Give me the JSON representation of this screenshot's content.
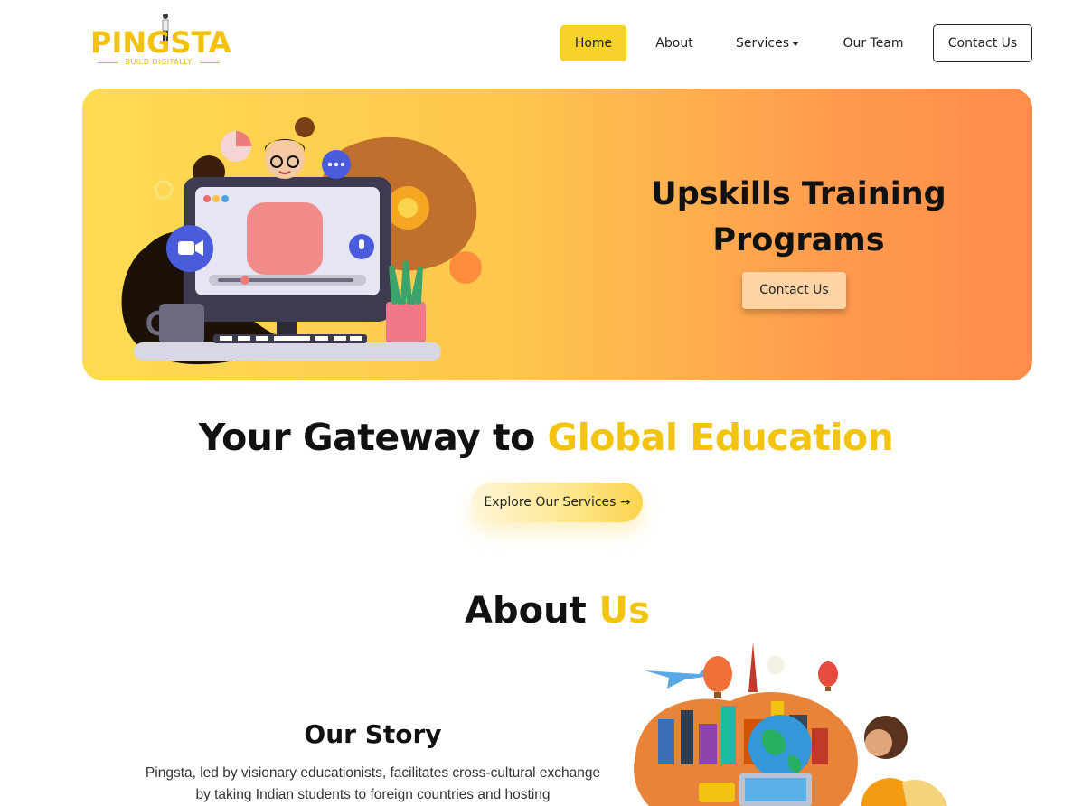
{
  "brand": {
    "name": "PINGSTA",
    "tagline": "BUILD DIGITALLY",
    "color": "#f2c20f"
  },
  "nav": {
    "items": [
      {
        "label": "Home",
        "active": true
      },
      {
        "label": "About"
      },
      {
        "label": "Services",
        "has_dropdown": true
      },
      {
        "label": "Our Team"
      }
    ],
    "contact_label": "Contact Us"
  },
  "hero": {
    "title": "Upskills Training Programs",
    "button_label": "Contact Us",
    "gradient": [
      "#fedc52",
      "#ff8c4b"
    ]
  },
  "gateway": {
    "prefix": "Your Gateway to",
    "highlight": "Global Education",
    "button_label": "Explore Our Services →"
  },
  "about": {
    "title_prefix": "About",
    "title_highlight": "Us",
    "story_title": "Our Story",
    "story_text": "Pingsta, led by visionary educationists, facilitates cross-cultural exchange by taking Indian students to foreign countries and hosting"
  },
  "colors": {
    "accent": "#f2c40e",
    "nav_active_bg": "#f7d22b"
  }
}
